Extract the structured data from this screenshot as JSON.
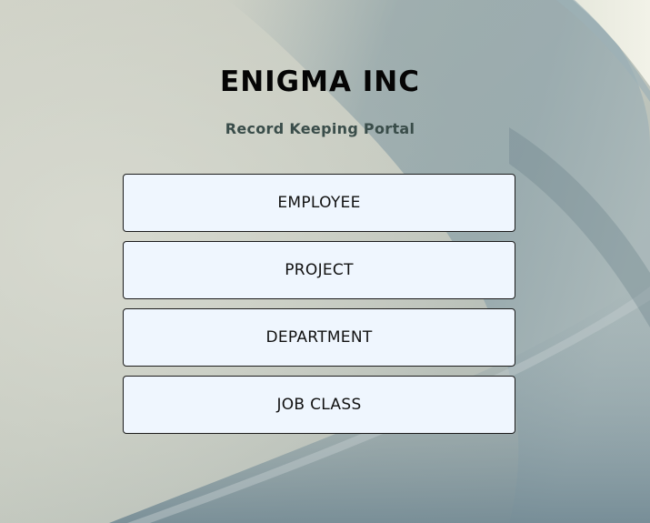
{
  "header": {
    "title": "ENIGMA INC",
    "subtitle": "Record Keeping Portal"
  },
  "menu": {
    "items": [
      {
        "label": "EMPLOYEE"
      },
      {
        "label": "PROJECT"
      },
      {
        "label": "DEPARTMENT"
      },
      {
        "label": "JOB CLASS"
      }
    ]
  },
  "colors": {
    "title": "#050505",
    "subtitle": "#3a4d4a",
    "button_background": "#eff6fe",
    "button_border": "#1c1c1c"
  }
}
